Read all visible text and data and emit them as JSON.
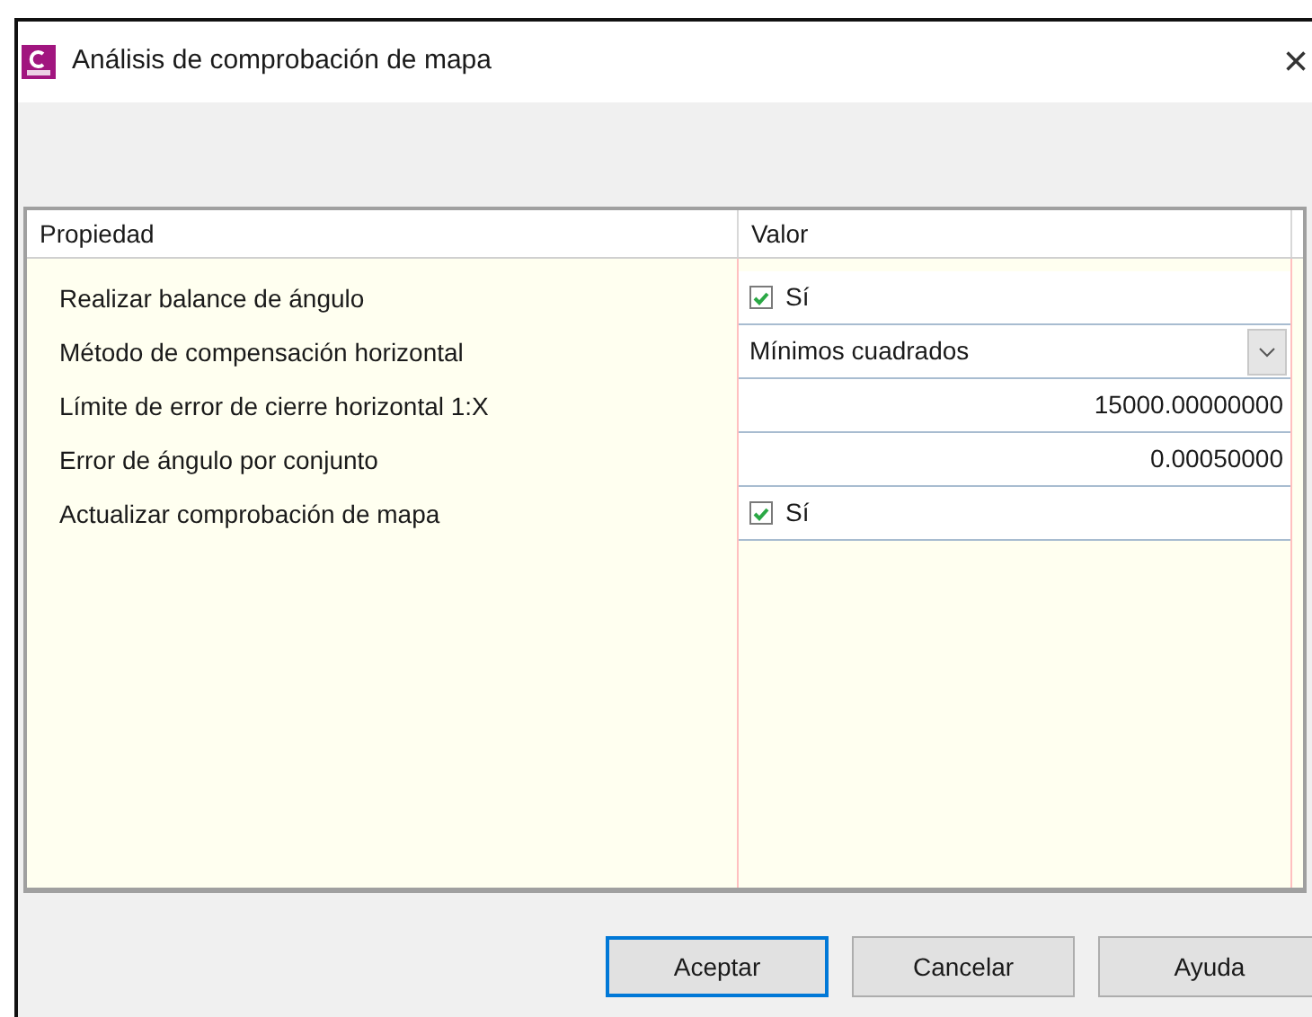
{
  "window": {
    "title": "Análisis de comprobación de mapa",
    "close": "×"
  },
  "grid": {
    "columns": [
      "Propiedad",
      "Valor"
    ],
    "rows": [
      {
        "label": "Realizar balance de ángulo",
        "kind": "checkbox",
        "checked": true,
        "value": "Sí"
      },
      {
        "label": "Método de compensación horizontal",
        "kind": "dropdown",
        "value": "Mínimos cuadrados"
      },
      {
        "label": "Límite de error de cierre horizontal 1:X",
        "kind": "number",
        "value": "15000.00000000"
      },
      {
        "label": "Error de ángulo por conjunto",
        "kind": "number",
        "value": "0.00050000"
      },
      {
        "label": "Actualizar comprobación de mapa",
        "kind": "checkbox",
        "checked": true,
        "value": "Sí"
      }
    ]
  },
  "buttons": [
    {
      "label": "Aceptar",
      "default": true
    },
    {
      "label": "Cancelar",
      "default": false
    },
    {
      "label": "Ayuda",
      "default": false
    }
  ]
}
